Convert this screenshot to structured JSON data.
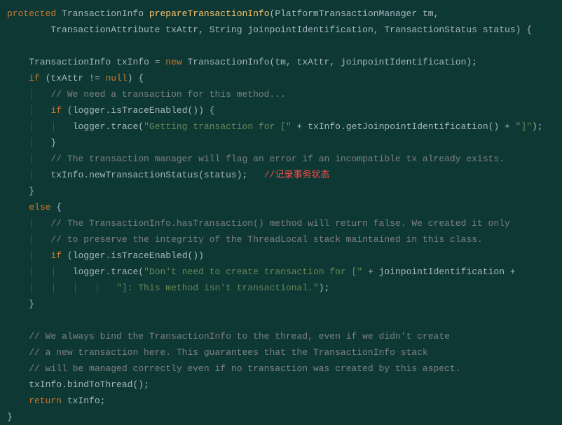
{
  "code": {
    "l1": {
      "kw_protected": "protected",
      "type1": "TransactionInfo",
      "method": "prepareTransactionInfo",
      "paren_open": "(",
      "type2": "PlatformTransactionManager",
      "p1": "tm",
      "comma": ","
    },
    "l2": {
      "type1": "TransactionAttribute",
      "p1": "txAttr",
      "c1": ", ",
      "type2": "String",
      "p2": "joinpointIdentification",
      "c2": ", ",
      "type3": "TransactionStatus",
      "p3": "status",
      "close": ") {"
    },
    "l4": {
      "type": "TransactionInfo",
      "var": "txInfo",
      "eq": " = ",
      "kw_new": "new",
      "ctor": "TransactionInfo",
      "args": "(tm, txAttr, joinpointIdentification);"
    },
    "l5": {
      "kw_if": "if",
      "cond": " (txAttr != ",
      "kw_null": "null",
      "close": ") {"
    },
    "l6": {
      "cmt": "// We need a transaction for this method..."
    },
    "l7": {
      "kw_if": "if",
      "open": " (",
      "obj": "logger",
      "dot": ".",
      "call": "isTraceEnabled",
      "close": "()) {"
    },
    "l8": {
      "obj": "logger",
      "dot": ".",
      "call": "trace",
      "open": "(",
      "str1": "\"Getting transaction for [\"",
      "plus1": " + ",
      "obj2": "txInfo",
      "dot2": ".",
      "call2": "getJoinpointIdentification",
      "paren2": "()",
      "plus2": " + ",
      "str2": "\"]\"",
      "end": ");"
    },
    "l9": {
      "brace": "}"
    },
    "l10": {
      "cmt": "// The transaction manager will flag an error if an incompatible tx already exists."
    },
    "l11": {
      "obj": "txInfo",
      "dot": ".",
      "call": "newTransactionStatus",
      "args": "(status);",
      "sp": "   ",
      "cmt": "//记录事务状态"
    },
    "l12": {
      "brace": "}"
    },
    "l13": {
      "kw_else": "else",
      "brace": " {"
    },
    "l14": {
      "cmt": "// The TransactionInfo.hasTransaction() method will return false. We created it only"
    },
    "l15": {
      "cmt": "// to preserve the integrity of the ThreadLocal stack maintained in this class."
    },
    "l16": {
      "kw_if": "if",
      "open": " (",
      "obj": "logger",
      "dot": ".",
      "call": "isTraceEnabled",
      "close": "())"
    },
    "l17": {
      "obj": "logger",
      "dot": ".",
      "call": "trace",
      "open": "(",
      "str1": "\"Don't need to create transaction for [\"",
      "plus1": " + ",
      "var": "joinpointIdentification",
      "plus2": " +"
    },
    "l18": {
      "str": "\"]: This method isn't transactional.\"",
      "end": ");"
    },
    "l19": {
      "brace": "}"
    },
    "l21": {
      "cmt": "// We always bind the TransactionInfo to the thread, even if we didn't create"
    },
    "l22": {
      "cmt": "// a new transaction here. This guarantees that the TransactionInfo stack"
    },
    "l23": {
      "cmt": "// will be managed correctly even if no transaction was created by this aspect."
    },
    "l24": {
      "obj": "txInfo",
      "dot": ".",
      "call": "bindToThread",
      "end": "();"
    },
    "l25": {
      "kw_return": "return",
      "var": " txInfo",
      "semi": ";"
    },
    "l26": {
      "brace": "}"
    }
  }
}
